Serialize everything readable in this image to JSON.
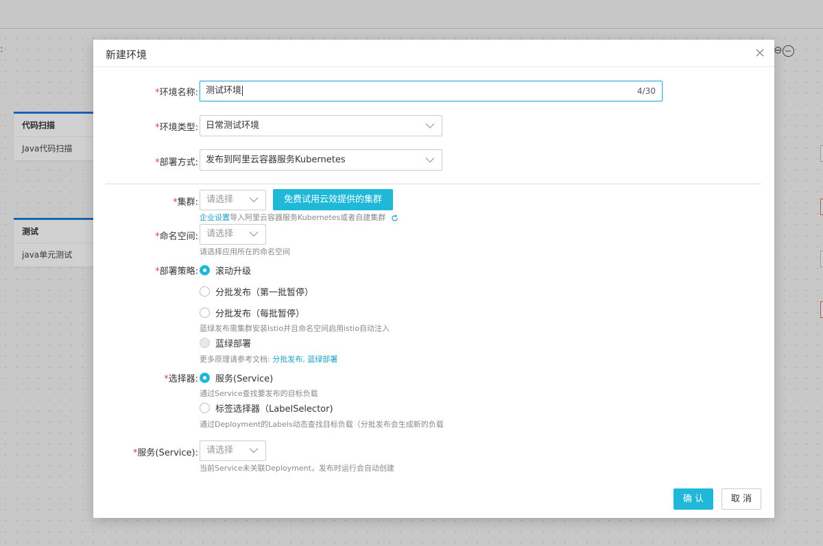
{
  "background": {
    "card1": {
      "title": "代码扫描",
      "item": "Java代码扫描"
    },
    "card2": {
      "title": "测试",
      "item": "java单元测试"
    }
  },
  "dialog": {
    "title": "新建环境",
    "env_name": {
      "label": "环境名称:",
      "value": "测试环境",
      "count": "4/30"
    },
    "env_type": {
      "label": "环境类型:",
      "value": "日常测试环境"
    },
    "deploy_method": {
      "label": "部署方式:",
      "value": "发布到阿里云容器服务Kubernetes"
    },
    "cluster": {
      "label": "集群:",
      "placeholder": "请选择",
      "trial_button": "免费试用云效提供的集群",
      "help_link": "企业设置",
      "help_text": "导入阿里云容器服务Kubernetes或者自建集群"
    },
    "namespace": {
      "label": "命名空间:",
      "placeholder": "请选择",
      "help": "请选择应用所在的命名空间"
    },
    "strategy": {
      "label": "部署策略:",
      "options": [
        "滚动升级",
        "分批发布（第一批暂停）",
        "分批发布（每批暂停）",
        "蓝绿部署"
      ],
      "selected": "滚动升级",
      "bluegreen_note": "蓝绿发布需集群安装Istio并且命名空间启用istio自动注入",
      "docs_prefix": "更多原理请参考文档:",
      "docs_link1": "分批发布",
      "docs_sep": ",",
      "docs_link2": "蓝绿部署"
    },
    "selector": {
      "label": "选择器:",
      "option1": "服务(Service)",
      "option1_help": "通过Service查找要发布的目标负载",
      "option2": "标签选择器（LabelSelector)",
      "option2_help": "通过Deployment的Labels动态查找目标负载（分批发布会生成新的负载",
      "selected": "服务(Service)"
    },
    "service": {
      "label": "服务(Service):",
      "placeholder": "请选择",
      "help": "当前Service未关联Deployment，发布时运行会自动创建"
    },
    "confirm": "确 认",
    "cancel": "取 消"
  },
  "colors": {
    "primary": "#1fb8d8",
    "required": "#e4393c",
    "link": "#1d9fc8"
  }
}
